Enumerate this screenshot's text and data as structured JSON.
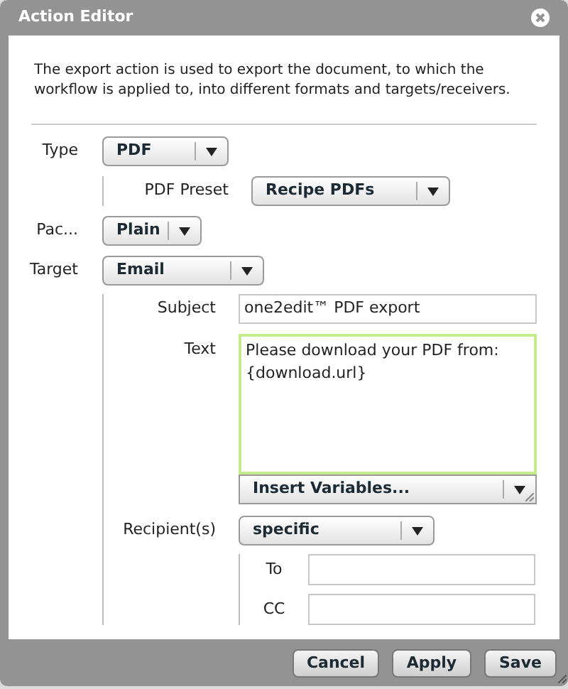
{
  "window": {
    "title": "Action Editor"
  },
  "description": "The export action is used to export the document, to which the workflow is applied to, into different formats and targets/receivers.",
  "type": {
    "label": "Type",
    "value": "PDF",
    "pdf_preset": {
      "label": "PDF Preset",
      "value": "Recipe PDFs"
    }
  },
  "package": {
    "label": "Pac...",
    "value": "Plain"
  },
  "target": {
    "label": "Target",
    "value": "Email",
    "subject": {
      "label": "Subject",
      "value": "one2edit™ PDF export"
    },
    "text": {
      "label": "Text",
      "value": "Please download your PDF from:\n{download.url}",
      "focused": true
    },
    "insert_variables": "Insert Variables...",
    "recipients": {
      "label": "Recipient(s)",
      "value": "specific",
      "to": {
        "label": "To"
      },
      "cc": {
        "label": "CC"
      }
    }
  },
  "buttons": [
    "Cancel",
    "Apply",
    "Save"
  ]
}
